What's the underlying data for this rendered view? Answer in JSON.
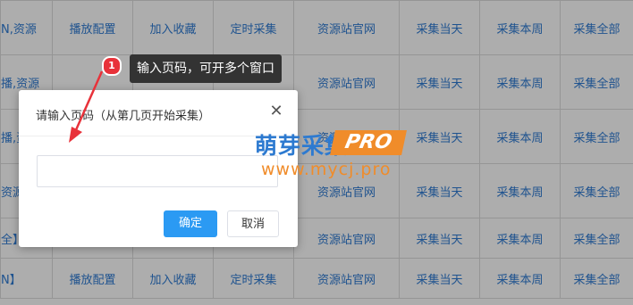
{
  "table": {
    "rows": [
      {
        "cells": [
          "N,资源",
          "播放配置",
          "加入收藏",
          "定时采集",
          "资源站官网",
          "采集当天",
          "采集本周",
          "采集全部"
        ]
      },
      {
        "cells": [
          "播,资源",
          "",
          "",
          "",
          "资源站官网",
          "采集当天",
          "采集本周",
          "采集全部"
        ]
      },
      {
        "cells": [
          "播,资",
          "",
          "",
          "",
          "资源站官网",
          "采集当天",
          "采集本周",
          "采集全部"
        ]
      },
      {
        "cells": [
          "资源",
          "",
          "",
          "",
          "资源站官网",
          "采集当天",
          "采集本周",
          "采集全部"
        ]
      },
      {
        "cells": [
          "全】",
          "",
          "",
          "",
          "资源站官网",
          "采集当天",
          "采集本周",
          "采集全部"
        ]
      },
      {
        "cells": [
          "N】",
          "播放配置",
          "加入收藏",
          "定时采集",
          "资源站官网",
          "采集当天",
          "采集本周",
          "采集全部"
        ]
      }
    ]
  },
  "dialog": {
    "title": "请输入页码（从第几页开始采集）",
    "close_icon": "close-icon",
    "input_value": "",
    "ok_label": "确定",
    "cancel_label": "取消",
    "accent": "#2b9af3"
  },
  "annotation": {
    "badge_number": "1",
    "tooltip": "输入页码，可开多个窗口",
    "badge_color": "#e8323a"
  },
  "watermark": {
    "name_cn": "萌芽采集",
    "name_pro": "PRO",
    "url": "www.mycj.pro"
  }
}
